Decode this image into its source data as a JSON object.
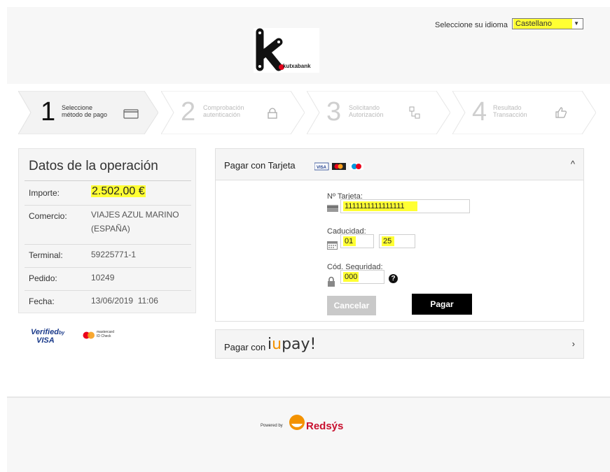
{
  "header": {
    "language_label": "Seleccione su idioma",
    "language_selected": "Castellano",
    "brand_name": "kutxabank"
  },
  "steps": [
    {
      "number": "1",
      "line1": "Seleccione",
      "line2": "método de pago",
      "icon": "card-icon",
      "state": "active"
    },
    {
      "number": "2",
      "line1": "Comprobación",
      "line2": "autenticación",
      "icon": "lock-icon",
      "state": "inactive"
    },
    {
      "number": "3",
      "line1": "Solicitando",
      "line2": "Autorización",
      "icon": "network-icon",
      "state": "inactive"
    },
    {
      "number": "4",
      "line1": "Resultado",
      "line2": "Transacción",
      "icon": "thumbs-up-icon",
      "state": "inactive"
    }
  ],
  "operation": {
    "title": "Datos de la operación",
    "rows": [
      {
        "label": "Importe:",
        "value": "2.502,00 €"
      },
      {
        "label": "Comercio:",
        "value": "VIAJES AZUL MARINO (ESPAÑA)"
      },
      {
        "label": "Terminal:",
        "value": "59225771-1"
      },
      {
        "label": "Pedido:",
        "value": "10249"
      },
      {
        "label": "Fecha:",
        "value": "13/06/2019  11:06"
      }
    ]
  },
  "badges": {
    "verified_line1": "Verified",
    "verified_by": "by",
    "verified_line2": "VISA",
    "mastercard_line1": "mastercard",
    "mastercard_line2": "ID Check"
  },
  "card": {
    "title": "Pagar con Tarjeta",
    "card_number_label": "Nº Tarjeta:",
    "card_number_value": "1111111111111111",
    "expiry_label": "Caducidad:",
    "expiry_month": "01",
    "expiry_year": "25",
    "cvv_label": "Cód. Seguridad:",
    "cvv_value": "000",
    "help_glyph": "?",
    "cancel_label": "Cancelar",
    "pay_label": "Pagar",
    "collapse_glyph": "^"
  },
  "iupay": {
    "title": "Pagar con",
    "brand_pre": "i",
    "brand_mid": "u",
    "brand_post": "pay!",
    "expand_glyph": "›"
  },
  "footer": {
    "powered_by": "Powered by",
    "brand": "Redsýs"
  },
  "colors": {
    "highlight": "#ffff33",
    "pay_button": "#000000",
    "cancel_button": "#c9c9c9",
    "redsys": "#c8102e",
    "redsys_orange": "#f39200"
  }
}
